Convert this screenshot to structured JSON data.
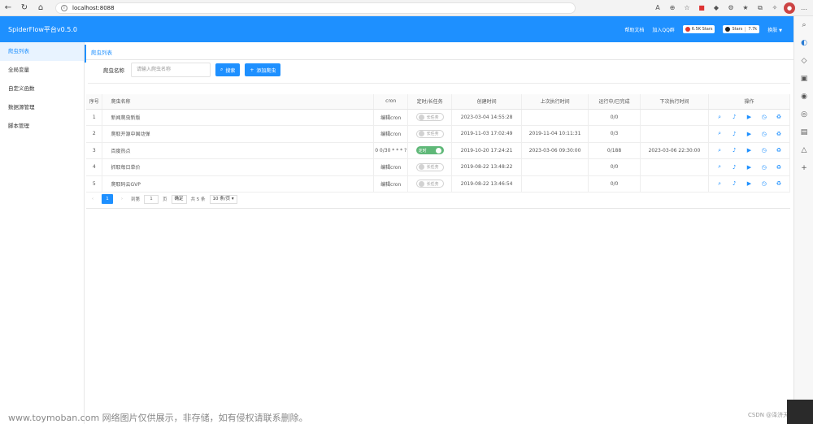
{
  "browser": {
    "url": "localhost:8088",
    "icons": [
      "back-icon",
      "refresh-icon",
      "home-icon"
    ]
  },
  "header": {
    "brand": "SpiderFlow平台v0.5.0",
    "help": "帮助文档",
    "qq": "加入QQ群",
    "gitee_stars": "6.5K Stars",
    "github_label": "Stars",
    "github_count": "7.7k",
    "skin": "换肤"
  },
  "sidebar": {
    "items": [
      {
        "label": "爬虫列表"
      },
      {
        "label": "全局变量"
      },
      {
        "label": "自定义函数"
      },
      {
        "label": "数据源管理"
      },
      {
        "label": "脚本管理"
      }
    ]
  },
  "tab": {
    "label": "爬虫列表"
  },
  "search": {
    "label": "爬虫名称",
    "placeholder": "请输入爬虫名称",
    "search_btn": "搜索",
    "add_btn": "添加爬虫"
  },
  "table": {
    "headers": [
      "序号",
      "爬虫名称",
      "cron",
      "定时/长任务",
      "创建时间",
      "上次执行时间",
      "运行中/已完成",
      "下次执行时间",
      "操作"
    ],
    "rows": [
      {
        "idx": "1",
        "name": "新闻爬虫新版",
        "cron": "编辑cron",
        "switch": "长任务",
        "on": false,
        "created": "2023-03-04 14:55:28",
        "last": "",
        "run": "0/0",
        "next": ""
      },
      {
        "idx": "2",
        "name": "爬取开源中国动弹",
        "cron": "编辑cron",
        "switch": "长任务",
        "on": false,
        "created": "2019-11-03 17:02:49",
        "last": "2019-11-04 10:11:31",
        "run": "0/3",
        "next": ""
      },
      {
        "idx": "3",
        "name": "百度热点",
        "cron": "0 0/30 * * * ?",
        "switch": "定时",
        "on": true,
        "created": "2019-10-20 17:24:21",
        "last": "2023-03-06 09:30:00",
        "run": "0/188",
        "next": "2023-03-06 22:30:00"
      },
      {
        "idx": "4",
        "name": "抓取每日单价",
        "cron": "编辑cron",
        "switch": "长任务",
        "on": false,
        "created": "2019-08-22 13:48:22",
        "last": "",
        "run": "0/0",
        "next": ""
      },
      {
        "idx": "5",
        "name": "爬取码云GVP",
        "cron": "编辑cron",
        "switch": "长任务",
        "on": false,
        "created": "2019-08-22 13:46:54",
        "last": "",
        "run": "0/0",
        "next": ""
      }
    ]
  },
  "pager": {
    "current": "1",
    "goto_label": "到第",
    "goto_value": "1",
    "page_unit": "页",
    "confirm": "确定",
    "total": "共 5 条",
    "per_page": "10 条/页"
  },
  "footer": {
    "watermark": "www.toymoban.com 网络图片仅供展示，非存储，如有侵权请联系删除。",
    "csdn": "CSDN @泽济天下"
  },
  "colors": {
    "primary": "#1e90ff",
    "switch_on": "#5fb878"
  }
}
